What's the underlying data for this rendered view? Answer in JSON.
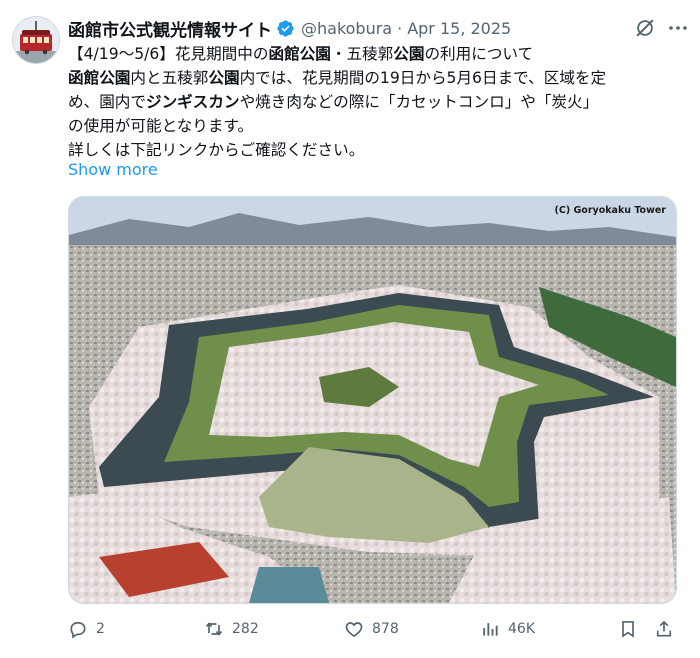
{
  "post": {
    "author_name": "函館市公式観光情報サイト",
    "handle": "@hakobura",
    "separator": "·",
    "date": "Apr 15, 2025",
    "lines": {
      "l1a": "【4/19〜5/6】花見期間中の",
      "l1b": "函館公園",
      "l1c": "・五稜郭",
      "l1d": "公園",
      "l1e": "の利用について",
      "l2a": "函館公園",
      "l2b": "内と五稜郭",
      "l2c": "公園",
      "l2d": "内では、花見期間の19日から5月6日まで、区域を定",
      "l3a": "め、園内で",
      "l3b": "ジンギスカン",
      "l3c": "や焼き肉などの際に「カセットコンロ」や「炭火」",
      "l4": "の使用が可能となります。",
      "l5": "詳しくは下記リンクからご確認ください。"
    },
    "show_more": "Show more",
    "image_credit": "(C) Goryokaku Tower"
  },
  "stats": {
    "replies": "2",
    "reposts": "282",
    "likes": "878",
    "views": "46K"
  },
  "icons": [
    "verified-badge-icon",
    "grok-icon",
    "more-icon",
    "reply-icon",
    "repost-icon",
    "like-icon",
    "views-icon",
    "bookmark-icon",
    "share-icon"
  ],
  "colors": {
    "link": "#1d9bf0",
    "verified": "#1d9bf0",
    "muted": "#536471"
  }
}
